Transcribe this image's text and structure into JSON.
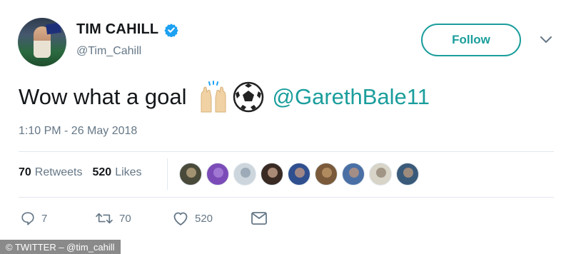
{
  "profile": {
    "display_name": "TIM CAHILL",
    "handle": "@Tim_Cahill",
    "verified": true,
    "avatar_icon": "profile-photo"
  },
  "follow_button": {
    "label": "Follow"
  },
  "menu_icon": "chevron-down-icon",
  "tweet": {
    "text": "Wow what a goal",
    "emojis": [
      "raising-hands-icon",
      "soccer-ball-icon"
    ],
    "mention": "@GarethBale11",
    "timestamp": "1:10 PM - 26 May 2018"
  },
  "stats": {
    "retweets_count": "70",
    "retweets_label": "Retweets",
    "likes_count": "520",
    "likes_label": "Likes"
  },
  "liker_avatars": [
    {
      "name": "liker-avatar-1",
      "color": "#4a4a3a",
      "accent": "#c8b08a"
    },
    {
      "name": "liker-avatar-2",
      "color": "#7b4bb8",
      "accent": "#b28ae0"
    },
    {
      "name": "liker-avatar-3",
      "color": "#cdd6dd",
      "accent": "#8899a6"
    },
    {
      "name": "liker-avatar-4",
      "color": "#3a2a24",
      "accent": "#d8b49a"
    },
    {
      "name": "liker-avatar-5",
      "color": "#2f4f8f",
      "accent": "#d0a080"
    },
    {
      "name": "liker-avatar-6",
      "color": "#7a5a3a",
      "accent": "#c8a070"
    },
    {
      "name": "liker-avatar-7",
      "color": "#4a6fa5",
      "accent": "#c89a7a"
    },
    {
      "name": "liker-avatar-8",
      "color": "#d8d4c8",
      "accent": "#8a7a6a"
    },
    {
      "name": "liker-avatar-9",
      "color": "#3a5a7a",
      "accent": "#c8a080"
    }
  ],
  "actions": {
    "reply_count": "7",
    "retweet_count": "70",
    "like_count": "520"
  },
  "watermark": "© TWITTER – @tim_cahill",
  "colors": {
    "accent": "#1a9e9c",
    "verified": "#1da1f2",
    "text": "#14171a",
    "secondary": "#657786",
    "divider": "#e1e8ed"
  }
}
